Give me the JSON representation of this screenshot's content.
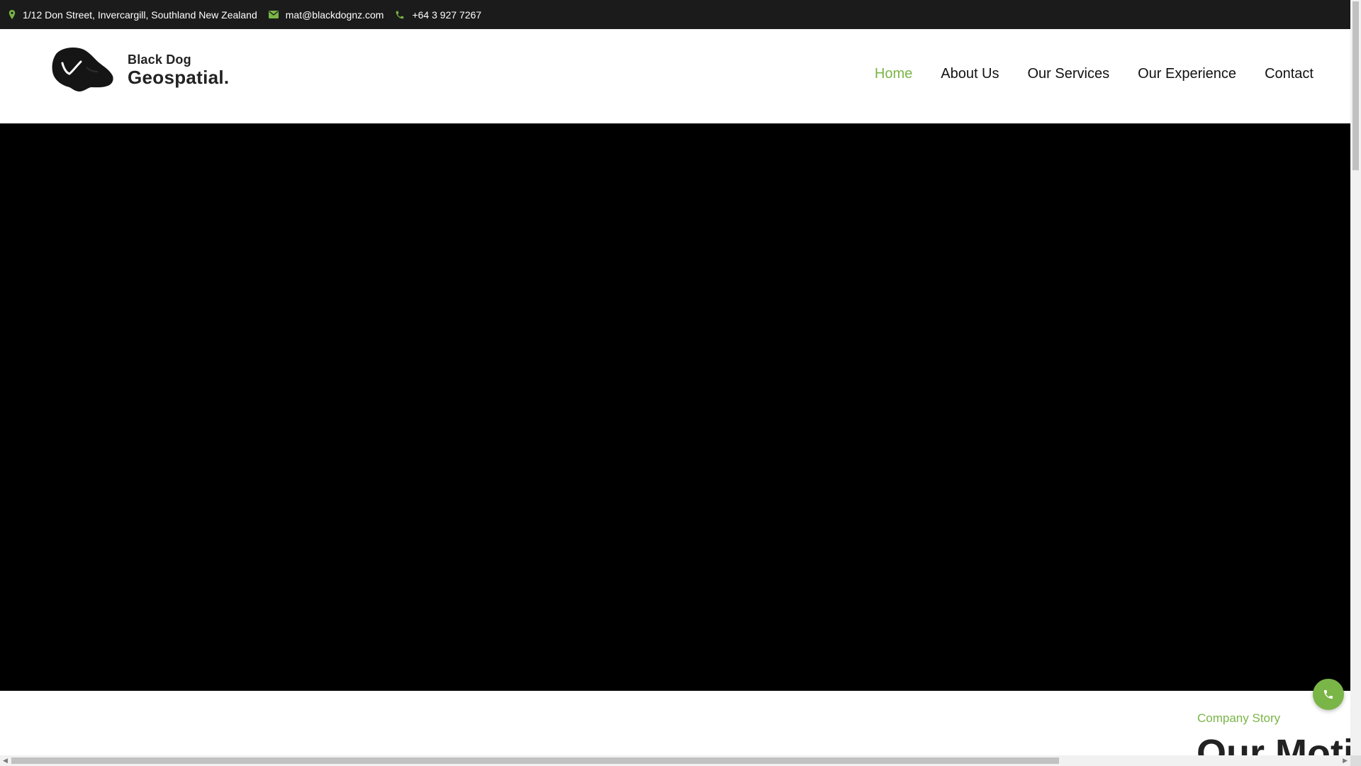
{
  "topbar": {
    "address": "1/12 Don Street, Invercargill, Southland New Zealand",
    "email": "mat@blackdognz.com",
    "phone": "+64 3 927 7267",
    "icons": [
      "map-pin-icon",
      "envelope-icon",
      "phone-icon"
    ]
  },
  "brand": {
    "line1": "Black Dog",
    "line2": "Geospatial."
  },
  "nav": {
    "items": [
      {
        "label": "Home",
        "active": true
      },
      {
        "label": "About Us",
        "active": false
      },
      {
        "label": "Our Services",
        "active": false
      },
      {
        "label": "Our Experience",
        "active": false
      },
      {
        "label": "Contact",
        "active": false
      }
    ]
  },
  "story": {
    "label": "Company Story",
    "title": "Our Motiva"
  },
  "colors": {
    "accent": "#7ab547",
    "topbar_bg": "#1b1b1b",
    "hero_bg": "#000000"
  }
}
